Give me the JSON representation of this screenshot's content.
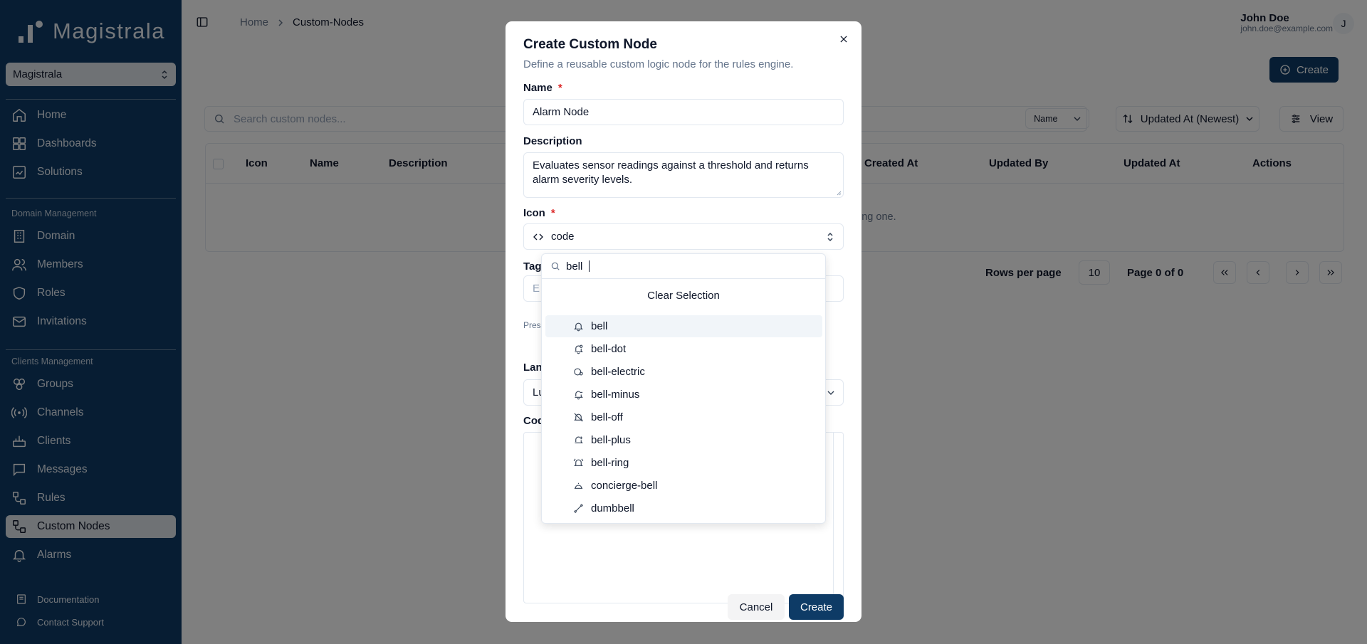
{
  "app": {
    "brand": "Magistrala"
  },
  "workspace": {
    "name": "Magistrala"
  },
  "sidebar": {
    "main_items": [
      {
        "label": "Home",
        "icon": "home-icon"
      },
      {
        "label": "Dashboards",
        "icon": "dashboard-icon"
      },
      {
        "label": "Solutions",
        "icon": "solutions-icon"
      }
    ],
    "domain_section": "Domain Management",
    "domain_items": [
      {
        "label": "Domain",
        "icon": "building-icon"
      },
      {
        "label": "Members",
        "icon": "users-icon"
      },
      {
        "label": "Roles",
        "icon": "shield-icon"
      },
      {
        "label": "Invitations",
        "icon": "mail-icon"
      }
    ],
    "clients_section": "Clients Management",
    "clients_items": [
      {
        "label": "Groups",
        "icon": "groups-icon"
      },
      {
        "label": "Channels",
        "icon": "channels-icon"
      },
      {
        "label": "Clients",
        "icon": "clients-icon"
      },
      {
        "label": "Messages",
        "icon": "messages-icon"
      },
      {
        "label": "Rules",
        "icon": "rules-icon"
      },
      {
        "label": "Custom Nodes",
        "icon": "custom-nodes-icon"
      },
      {
        "label": "Alarms",
        "icon": "bell-icon"
      }
    ],
    "footer_links": [
      {
        "label": "Documentation",
        "icon": "book-icon"
      },
      {
        "label": "Contact Support",
        "icon": "chat-icon"
      }
    ]
  },
  "breadcrumb": {
    "home": "Home",
    "current": "Custom-Nodes"
  },
  "user": {
    "name": "John Doe",
    "email": "john.doe@example.com",
    "initial": "J"
  },
  "toolbar": {
    "create_label": "Create",
    "search_placeholder": "Search custom nodes...",
    "filter_field": "Name",
    "sort_label": "Updated At (Newest)",
    "view_label": "View"
  },
  "table": {
    "columns": [
      "Icon",
      "Name",
      "Description",
      "Created At",
      "Updated By",
      "Updated At",
      "Actions"
    ],
    "empty_partial": "ing one."
  },
  "pagination": {
    "rows_per_page_label": "Rows per page",
    "rows_per_page": "10",
    "page_text": "Page 0 of 0"
  },
  "modal": {
    "title": "Create Custom Node",
    "subtitle": "Define a reusable custom logic node for the rules engine.",
    "name_label": "Name",
    "name_value": "Alarm Node",
    "description_label": "Description",
    "description_value": "Evaluates sensor readings against a threshold and returns alarm severity levels.",
    "icon_label": "Icon",
    "icon_value": "code",
    "tags_partial": "Tag",
    "tags_placeholder_partial": "E",
    "preset_partial": "Pres",
    "language_partial": "Lan",
    "language_value_partial": "Lu",
    "code_partial": "Cod",
    "cancel_label": "Cancel",
    "create_label": "Create",
    "required_mark": "*"
  },
  "icon_dropdown": {
    "search_value": "bell",
    "clear_label": "Clear Selection",
    "options": [
      "bell",
      "bell-dot",
      "bell-electric",
      "bell-minus",
      "bell-off",
      "bell-plus",
      "bell-ring",
      "concierge-bell",
      "dumbbell"
    ],
    "highlighted": "bell"
  },
  "colors": {
    "primary": "#0e3b66",
    "required": "#dc2626"
  }
}
